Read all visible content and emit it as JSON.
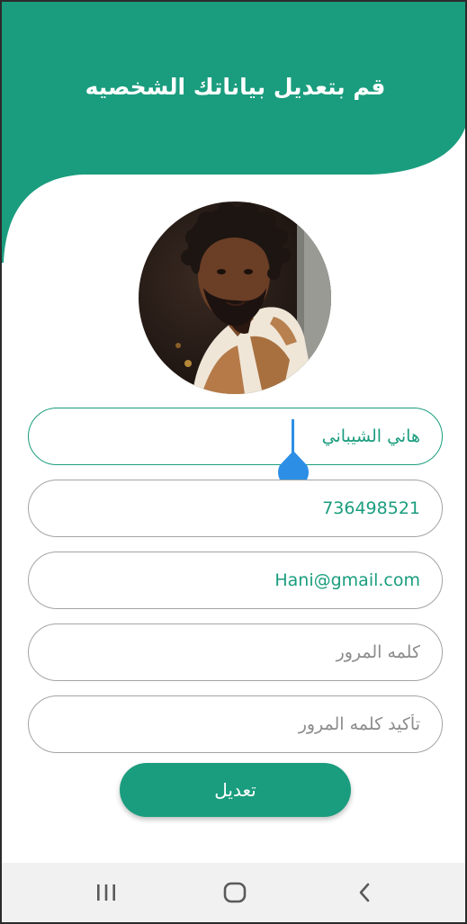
{
  "header": {
    "title": "قم بتعديل بياناتك الشخصيه"
  },
  "profile": {
    "avatar_alt": "صورة الملف الشخصي"
  },
  "form": {
    "name_value": "هاني الشيباني",
    "phone_value": "736498521",
    "email_value": "Hani@gmail.com",
    "password_placeholder": "كلمه المرور",
    "confirm_password_placeholder": "تأكيد كلمه المرور",
    "submit_label": "تعديل"
  },
  "navbar": {
    "recents_icon": "recents-icon",
    "home_icon": "home-icon",
    "back_icon": "back-icon"
  },
  "colors": {
    "accent": "#1a9d7e",
    "cursor": "#2d8ee5",
    "field_border": "#a4a4a4",
    "navbar_bg": "#f1f1f1"
  }
}
